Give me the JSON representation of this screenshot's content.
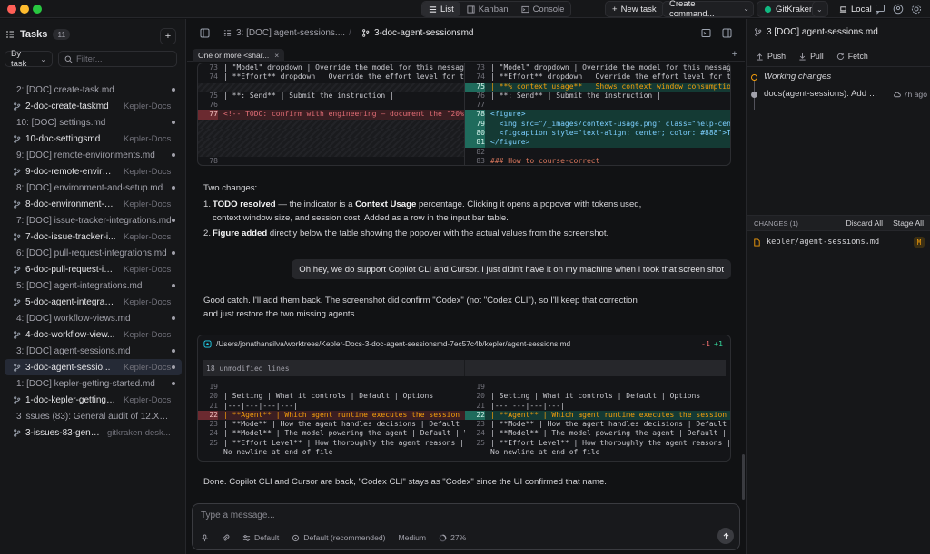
{
  "topbar": {
    "views": [
      "List",
      "Kanban",
      "Console"
    ],
    "new_task": "New task",
    "create_command": "Create command...",
    "gitkraken": "GitKraken",
    "local": "Local"
  },
  "sidebar": {
    "title": "Tasks",
    "count": "11",
    "group_by": "By task",
    "filter_placeholder": "Filter...",
    "tasks": [
      {
        "title": "2: [DOC] create-task.md",
        "branch": "2-doc-create-taskmd",
        "repo": "Kepler-Docs"
      },
      {
        "title": "10: [DOC] settings.md",
        "branch": "10-doc-settingsmd",
        "repo": "Kepler-Docs"
      },
      {
        "title": "9: [DOC] remote-environments.md",
        "branch": "9-doc-remote-environ...",
        "repo": "Kepler-Docs"
      },
      {
        "title": "8: [DOC] environment-and-setup.md",
        "branch": "8-doc-environment-a...",
        "repo": "Kepler-Docs"
      },
      {
        "title": "7: [DOC] issue-tracker-integrations.md",
        "branch": "7-doc-issue-tracker-i...",
        "repo": "Kepler-Docs"
      },
      {
        "title": "6: [DOC] pull-request-integrations.md",
        "branch": "6-doc-pull-request-in...",
        "repo": "Kepler-Docs"
      },
      {
        "title": "5: [DOC] agent-integrations.md",
        "branch": "5-doc-agent-integrati...",
        "repo": "Kepler-Docs"
      },
      {
        "title": "4: [DOC] workflow-views.md",
        "branch": "4-doc-workflow-view...",
        "repo": "Kepler-Docs"
      },
      {
        "title": "3: [DOC] agent-sessions.md",
        "branch": "3-doc-agent-sessio...",
        "repo": "Kepler-Docs"
      },
      {
        "title": "1: [DOC] kepler-getting-started.md",
        "branch": "1-doc-kepler-getting-...",
        "repo": "Kepler-Docs"
      },
      {
        "title": "3 issues (83): General audit of 12.X feat...",
        "branch": "3-issues-83-gene...",
        "repo": "gitkraken-desk..."
      }
    ]
  },
  "center": {
    "header_task": "3: [DOC] agent-sessions....",
    "header_branch": "3-doc-agent-sessionsmd",
    "tab_label": "One or more <shar...",
    "diff1": {
      "left": [
        {
          "n": "73",
          "t": "| \"Model\" dropdown | Override the model for this messag",
          "k": ""
        },
        {
          "n": "74",
          "t": "| **Effort** dropdown | Override the effort level for thi",
          "k": ""
        },
        {
          "n": "",
          "t": "",
          "k": "hatch"
        },
        {
          "n": "75",
          "t": "| **: Send** | Submit the instruction |",
          "k": ""
        },
        {
          "n": "76",
          "t": "",
          "k": ""
        },
        {
          "n": "77",
          "t": "<!-- TODO: confirm with engineering — document the \"20%\"",
          "k": "del"
        },
        {
          "n": "",
          "t": "",
          "k": "hatch"
        },
        {
          "n": "",
          "t": "",
          "k": "hatch"
        },
        {
          "n": "",
          "t": "",
          "k": "hatch"
        },
        {
          "n": "",
          "t": "",
          "k": "hatch"
        },
        {
          "n": "78",
          "t": "",
          "k": ""
        },
        {
          "n": "79",
          "t": "### How to course-correct",
          "k": ""
        }
      ],
      "right": [
        {
          "n": "73",
          "t": "| \"Model\" dropdown | Override the model for this messag",
          "k": ""
        },
        {
          "n": "74",
          "t": "| **Effort** dropdown | Override the effort level for thi",
          "k": ""
        },
        {
          "n": "75",
          "t": "| **% context usage** | Shows context window consumption",
          "k": "add"
        },
        {
          "n": "76",
          "t": "| **: Send** | Submit the instruction |",
          "k": ""
        },
        {
          "n": "77",
          "t": "",
          "k": ""
        },
        {
          "n": "78",
          "t": "<figure>",
          "k": "add"
        },
        {
          "n": "79",
          "t": "  <img src=\"/_images/context-usage.png\" class=\"help-cente",
          "k": "add"
        },
        {
          "n": "80",
          "t": "  <figcaption style=\"text-align: center; color: #888\">The",
          "k": "add"
        },
        {
          "n": "81",
          "t": "</figure>",
          "k": "add"
        },
        {
          "n": "82",
          "t": "",
          "k": ""
        },
        {
          "n": "83",
          "t": "### How to course-correct",
          "k": ""
        }
      ]
    },
    "msg1_intro": "Two changes:",
    "msg1_item1_bold1": "TODO resolved",
    "msg1_item1_mid": " — the indicator is a ",
    "msg1_item1_bold2": "Context Usage",
    "msg1_item1_rest": " percentage. Clicking it opens a popover with tokens used,",
    "msg1_item1_line2": "context window size, and session cost. Added as a row in the input bar table.",
    "msg1_item2_bold": "Figure added",
    "msg1_item2_rest": " directly below the table showing the popover with the actual values from the screenshot.",
    "user_bubble": "Oh hey, we do support Copilot CLI and Cursor. I just didn't have it on my machine when I took that screen shot",
    "msg2_line1": "Good catch. I'll add them back. The screenshot did confirm \"Codex\" (not \"Codex CLI\"), so I'll keep that correction",
    "msg2_line2": "and just restore the two missing agents.",
    "diff2": {
      "path": "/Users/jonathansilva/worktrees/Kepler-Docs-3-doc-agent-sessionsmd-7ec57c4b/kepler/agent-sessions.md",
      "removed": "-1",
      "added": "+1",
      "unmodified": "18 unmodified lines",
      "left": [
        {
          "n": "19",
          "t": "",
          "k": ""
        },
        {
          "n": "20",
          "t": "| Setting | What it controls | Default | Options |",
          "k": ""
        },
        {
          "n": "21",
          "t": "|---|---|---|---|",
          "k": ""
        },
        {
          "n": "22",
          "t": "| **Agent** | Which agent runtime executes the session |",
          "k": "del"
        },
        {
          "n": "23",
          "t": "| **Mode** | How the agent handles decisions | Default |",
          "k": ""
        },
        {
          "n": "24",
          "t": "| **Model** | The model powering the agent | Default | Va",
          "k": ""
        },
        {
          "n": "25",
          "t": "| **Effort Level** | How thoroughly the agent reasons | D",
          "k": ""
        },
        {
          "n": "",
          "t": "No newline at end of file",
          "k": ""
        }
      ],
      "right": [
        {
          "n": "19",
          "t": "",
          "k": ""
        },
        {
          "n": "20",
          "t": "| Setting | What it controls | Default | Options |",
          "k": ""
        },
        {
          "n": "21",
          "t": "|---|---|---|---|",
          "k": ""
        },
        {
          "n": "22",
          "t": "| **Agent** | Which agent runtime executes the session |",
          "k": "add"
        },
        {
          "n": "23",
          "t": "| **Mode** | How the agent handles decisions | Default |",
          "k": ""
        },
        {
          "n": "24",
          "t": "| **Model** | The model powering the agent | Default | Va",
          "k": ""
        },
        {
          "n": "25",
          "t": "| **Effort Level** | How thoroughly the agent reasons | D",
          "k": ""
        },
        {
          "n": "",
          "t": "No newline at end of file",
          "k": ""
        }
      ]
    },
    "msg3": "Done. Copilot CLI and Cursor are back, \"Codex CLI\" stays as \"Codex\" since the UI confirmed that name.",
    "composer": {
      "placeholder": "Type a message...",
      "profile": "Default",
      "model": "Default (recommended)",
      "effort": "Medium",
      "context": "27%"
    }
  },
  "right_panel": {
    "title": "3 [DOC] agent-sessions.md",
    "push": "Push",
    "pull": "Pull",
    "fetch": "Fetch",
    "working_changes": "Working changes",
    "commit_message": "docs(agent-sessions): Add co...",
    "commit_time": "7h ago",
    "changes_label": "CHANGES (1)",
    "discard_all": "Discard All",
    "stage_all": "Stage All",
    "file": "kepler/agent-sessions.md",
    "file_status": "M"
  },
  "colors": {
    "accent_add": "#1f6b5c",
    "accent_del": "#6b2a30",
    "modified": "#f59e0b"
  }
}
